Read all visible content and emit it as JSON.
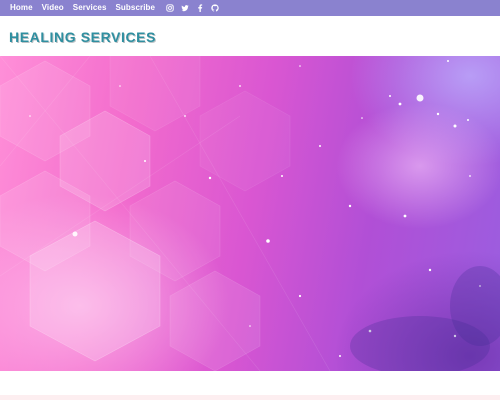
{
  "nav": {
    "links": [
      "Home",
      "Video",
      "Services",
      "Subscribe"
    ],
    "socials": [
      "instagram-icon",
      "twitter-icon",
      "facebook-icon",
      "github-icon"
    ]
  },
  "header": {
    "title": "HEALING SERVICES"
  },
  "hero": {
    "image": "pink-purple-cosmic-hexagon-background"
  },
  "colors": {
    "topbar": "#8a82cf",
    "title": "#2f8fa0",
    "hero_left": "#ff8fd8",
    "hero_right": "#9a5ee0",
    "bottom_strip": "#fdeef0"
  }
}
